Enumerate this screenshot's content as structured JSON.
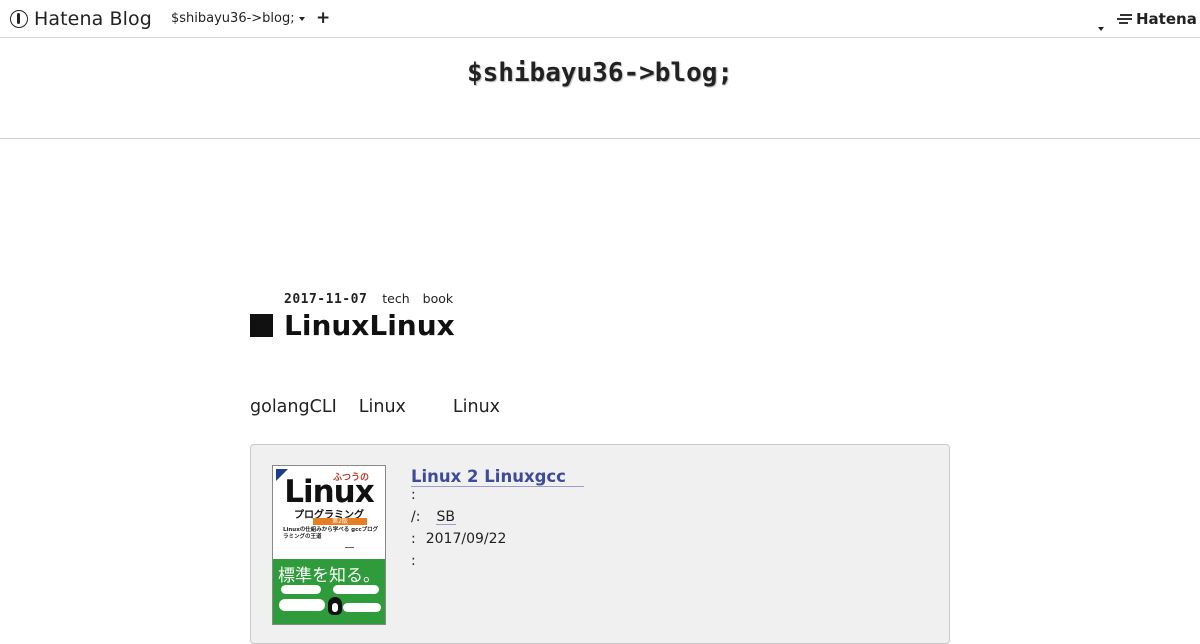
{
  "globalbar": {
    "logo_text": "Hatena Blog",
    "blog_selector_label": "$shibayu36->blog;",
    "add_label": "+",
    "hatena_label": "Hatena"
  },
  "blog": {
    "title": "$shibayu36->blog;"
  },
  "entry": {
    "date": "2017-11-07",
    "categories": [
      "tech",
      "book"
    ],
    "title": "LinuxLinux",
    "body_segments": [
      "golangCLI",
      "Linux",
      "Linux"
    ]
  },
  "product": {
    "cover": {
      "top_label": "ふつうの",
      "title": "Linux",
      "subtitle": "プログラミング",
      "edition": "第2版",
      "tagline": "Linuxの仕組みから学べる gccプログラミングの王道",
      "bottom_title": "標準を知る。"
    },
    "title": "Linux 2 Linuxgcc",
    "author_line": ":",
    "maker_prefix": "/:",
    "maker": "SB",
    "date_prefix": ":",
    "date": "2017/09/22",
    "extra_line": ":"
  },
  "colors": {
    "link": "#3e4a9c",
    "box_bg": "#f0f0f0",
    "cover_green": "#2e9c3b"
  }
}
